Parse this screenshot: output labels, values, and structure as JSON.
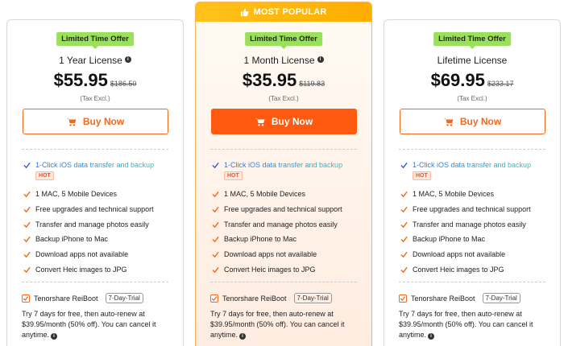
{
  "cards": [
    {
      "offer": "Limited Time Offer",
      "plan": "1 Year License",
      "price": "$55.95",
      "old_price": "$186.50",
      "tax": "(Tax Excl.)",
      "buy": "Buy Now",
      "features": [
        {
          "text": "1-Click iOS data transfer and backup",
          "icon": "check-icon",
          "badge": "HOT"
        },
        {
          "text": "1 MAC, 5 Mobile Devices",
          "icon": "checkmark-orange-icon"
        },
        {
          "text": "Free upgrades and technical support",
          "icon": "checkmark-orange-icon"
        },
        {
          "text": "Transfer and manage photos easily",
          "icon": "checkmark-orange-icon"
        },
        {
          "text": "Backup iPhone to Mac",
          "icon": "checkmark-orange-icon"
        },
        {
          "text": "Download apps not available",
          "icon": "checkmark-orange-icon"
        },
        {
          "text": "Convert Heic images to JPG",
          "icon": "checkmark-orange-icon"
        }
      ],
      "addon": "Tenorshare ReiBoot",
      "trial_tag": "7-Day-Trial",
      "trial_desc": "Try 7 days for free, then auto-renew at $39.95/month (50% off). You can cancel it anytime."
    },
    {
      "popular": "MOST POPULAR",
      "offer": "Limited Time Offer",
      "plan": "1 Month License",
      "price": "$35.95",
      "old_price": "$119.83",
      "tax": "(Tax Excl.)",
      "buy": "Buy Now",
      "features": [
        {
          "text": "1-Click iOS data transfer and backup",
          "icon": "check-icon",
          "badge": "HOT"
        },
        {
          "text": "1 MAC, 5 Mobile Devices",
          "icon": "checkmark-orange-icon"
        },
        {
          "text": "Free upgrades and technical support",
          "icon": "checkmark-orange-icon"
        },
        {
          "text": "Transfer and manage photos easily",
          "icon": "checkmark-orange-icon"
        },
        {
          "text": "Backup iPhone to Mac",
          "icon": "checkmark-orange-icon"
        },
        {
          "text": "Download apps not available",
          "icon": "checkmark-orange-icon"
        },
        {
          "text": "Convert Heic images to JPG",
          "icon": "checkmark-orange-icon"
        }
      ],
      "addon": "Tenorshare ReiBoot",
      "trial_tag": "7-Day-Trial",
      "trial_desc": "Try 7 days for free, then auto-renew at $39.95/month (50% off). You can cancel it anytime."
    },
    {
      "offer": "Limited Time Offer",
      "plan": "Lifetime License",
      "price": "$69.95",
      "old_price": "$233.17",
      "tax": "(Tax Excl.)",
      "buy": "Buy Now",
      "features": [
        {
          "text": "1-Click iOS data transfer and backup",
          "icon": "check-icon",
          "badge": "HOT"
        },
        {
          "text": "1 MAC, 5 Mobile Devices",
          "icon": "checkmark-orange-icon"
        },
        {
          "text": "Free upgrades and technical support",
          "icon": "checkmark-orange-icon"
        },
        {
          "text": "Transfer and manage photos easily",
          "icon": "checkmark-orange-icon"
        },
        {
          "text": "Backup iPhone to Mac",
          "icon": "checkmark-orange-icon"
        },
        {
          "text": "Download apps not available",
          "icon": "checkmark-orange-icon"
        },
        {
          "text": "Convert Heic images to JPG",
          "icon": "checkmark-orange-icon"
        }
      ],
      "addon": "Tenorshare ReiBoot",
      "trial_tag": "7-Day-Trial",
      "trial_desc": "Try 7 days for free, then auto-renew at $39.95/month (50% off). You can cancel it anytime."
    }
  ],
  "colors": {
    "accent_orange": "#ff5a10",
    "offer_green": "#9be05a",
    "popular_yellow": "#ffc21a"
  }
}
